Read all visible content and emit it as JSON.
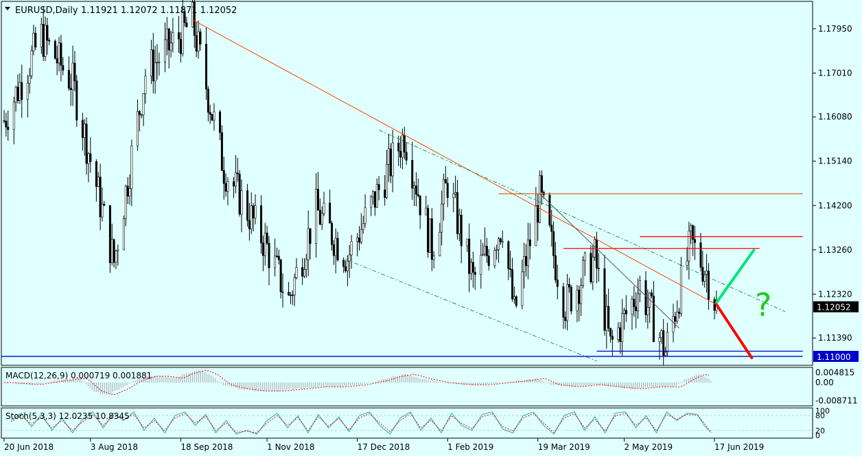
{
  "header": {
    "symbol": "EURUSD,Daily",
    "ohlc": "1.11921 1.12072 1.11871 1.12052"
  },
  "colors": {
    "background": "#e0ffff",
    "candle": "#000000",
    "trendline": "#ff4500",
    "channel": "#2e8b57",
    "resistance_orange": "#d2691e",
    "resistance_red": "#ff0000",
    "support_blue": "#0000cd",
    "bullish_arrow": "#00e676",
    "bearish_arrow": "#ff0000",
    "question_mark": "#22cc22",
    "macd_signal": "#ff0000",
    "macd_hist": "#a9a9a9",
    "stoch_main": "#20b2aa",
    "stoch_signal": "#ff0000"
  },
  "chart_data": [
    {
      "type": "candlestick",
      "title": "EURUSD,Daily",
      "ylim": [
        1.1081,
        1.1853
      ],
      "y_ticks": [
        "1.17950",
        "1.17010",
        "1.16080",
        "1.15140",
        "1.14200",
        "1.13260",
        "1.12320",
        "1.11390"
      ],
      "current_price": "1.12052",
      "support_label": "1.11000",
      "x_ticks": [
        "20 Jun 2018",
        "3 Aug 2018",
        "18 Sep 2018",
        "1 Nov 2018",
        "17 Dec 2018",
        "1 Feb 2019",
        "19 Mar 2019",
        "2 May 2019",
        "17 Jun 2019"
      ],
      "swing_points": [
        {
          "date": "2018-06-20",
          "price": 1.16
        },
        {
          "date": "2018-07-09",
          "price": 1.178
        },
        {
          "date": "2018-07-25",
          "price": 1.168
        },
        {
          "date": "2018-08-15",
          "price": 1.13
        },
        {
          "date": "2018-08-31",
          "price": 1.17
        },
        {
          "date": "2018-09-24",
          "price": 1.181
        },
        {
          "date": "2018-10-10",
          "price": 1.15
        },
        {
          "date": "2018-10-31",
          "price": 1.134
        },
        {
          "date": "2018-11-12",
          "price": 1.122
        },
        {
          "date": "2018-11-26",
          "price": 1.141
        },
        {
          "date": "2018-12-12",
          "price": 1.131
        },
        {
          "date": "2019-01-10",
          "price": 1.157
        },
        {
          "date": "2019-01-24",
          "price": 1.133
        },
        {
          "date": "2019-02-01",
          "price": 1.147
        },
        {
          "date": "2019-02-14",
          "price": 1.126
        },
        {
          "date": "2019-03-01",
          "price": 1.138
        },
        {
          "date": "2019-03-07",
          "price": 1.119
        },
        {
          "date": "2019-03-20",
          "price": 1.144
        },
        {
          "date": "2019-04-02",
          "price": 1.121
        },
        {
          "date": "2019-04-17",
          "price": 1.131
        },
        {
          "date": "2019-04-25",
          "price": 1.112
        },
        {
          "date": "2019-05-10",
          "price": 1.125
        },
        {
          "date": "2019-05-23",
          "price": 1.111
        },
        {
          "date": "2019-06-05",
          "price": 1.134
        },
        {
          "date": "2019-06-13",
          "price": 1.128
        },
        {
          "date": "2019-06-18",
          "price": 1.1205
        }
      ],
      "annotations": {
        "question_mark": "?",
        "horizontal_lines": [
          {
            "price": 1.1445,
            "from": "2019-02-27",
            "to": "2019-08-01",
            "color": "#d2691e"
          },
          {
            "price": 1.1354,
            "from": "2019-05-10",
            "to": "2019-08-01",
            "color": "#ff0000"
          },
          {
            "price": 1.1329,
            "from": "2019-04-01",
            "to": "2019-07-10",
            "color": "#ff0000"
          },
          {
            "price": 1.1111,
            "from": "2019-04-18",
            "to": "2019-08-01",
            "color": "#0000cd"
          },
          {
            "price": 1.11,
            "from": "2018-06-01",
            "to": "2019-08-01",
            "color": "#0000cd"
          }
        ],
        "trendlines": [
          {
            "from": [
              "2018-09-24",
              1.1814
            ],
            "to": [
              "2019-06-18",
              1.121
            ],
            "color": "#ff4500"
          },
          {
            "from": [
              "2019-03-20",
              1.1445
            ],
            "to": [
              "2019-05-30",
              1.116
            ],
            "color": "#555555"
          },
          {
            "from": [
              "2018-12-28",
              1.158
            ],
            "to": [
              "2019-07-23",
              1.1195
            ],
            "color": "#2e8b57",
            "dashed": true
          },
          {
            "from": [
              "2018-12-11",
              1.1306
            ],
            "to": [
              "2019-04-18",
              1.109
            ],
            "color": "#2e8b57",
            "dashed": true
          }
        ],
        "arrows": [
          {
            "from": [
              "2019-06-18",
              1.1214
            ],
            "to": [
              "2019-07-07",
              1.1325
            ],
            "color": "#00e676"
          },
          {
            "from": [
              "2019-06-18",
              1.121
            ],
            "to": [
              "2019-07-06",
              1.1097
            ],
            "color": "#ff0000"
          }
        ]
      }
    },
    {
      "type": "line",
      "title": "MACD(12,26,9) 0.000719 0.001881",
      "y_ticks": [
        "0.004815",
        "0.00",
        "-0.008711"
      ],
      "ylim": [
        -0.0105,
        0.0066
      ],
      "series": [
        {
          "values": [
            [
              0,
              0.0
            ],
            [
              40,
              -0.001
            ],
            [
              80,
              0.001
            ],
            [
              110,
              0.002
            ],
            [
              130,
              -0.004
            ],
            [
              148,
              -0.006
            ],
            [
              170,
              -0.003
            ],
            [
              190,
              0.001
            ],
            [
              210,
              0.003
            ],
            [
              230,
              0.003
            ],
            [
              250,
              0.002
            ],
            [
              262,
              0.004
            ],
            [
              285,
              0.006
            ],
            [
              300,
              0.004
            ],
            [
              320,
              -0.001
            ],
            [
              345,
              -0.003
            ],
            [
              370,
              -0.004
            ],
            [
              400,
              -0.004
            ],
            [
              430,
              -0.003
            ],
            [
              460,
              -0.002
            ],
            [
              490,
              -0.002
            ],
            [
              520,
              -0.001
            ],
            [
              550,
              0.001
            ],
            [
              570,
              0.003
            ],
            [
              590,
              0.004
            ],
            [
              610,
              0.002
            ],
            [
              640,
              0.0
            ],
            [
              670,
              -0.001
            ],
            [
              700,
              -0.001
            ],
            [
              730,
              0.0
            ],
            [
              760,
              0.001
            ],
            [
              780,
              0.002
            ],
            [
              800,
              -0.001
            ],
            [
              830,
              -0.002
            ],
            [
              860,
              -0.001
            ],
            [
              890,
              -0.002
            ],
            [
              920,
              -0.003
            ],
            [
              950,
              -0.002
            ],
            [
              980,
              -0.002
            ],
            [
              1000,
              0.002
            ],
            [
              1015,
              0.004
            ],
            [
              1025,
              0.003
            ],
            [
              1035,
              0.001
            ]
          ]
        }
      ]
    },
    {
      "type": "line",
      "title": "Stoch(5,3,3) 12.0235 10.8345",
      "y_ticks": [
        "100",
        "80",
        "20",
        "0"
      ],
      "ylim": [
        0,
        100
      ],
      "series": [
        {
          "values": [
            [
              10,
              60
            ],
            [
              25,
              90
            ],
            [
              40,
              35
            ],
            [
              55,
              85
            ],
            [
              70,
              20
            ],
            [
              85,
              70
            ],
            [
              100,
              10
            ],
            [
              115,
              65
            ],
            [
              130,
              95
            ],
            [
              145,
              30
            ],
            [
              160,
              90
            ],
            [
              175,
              60
            ],
            [
              190,
              95
            ],
            [
              205,
              20
            ],
            [
              220,
              70
            ],
            [
              235,
              10
            ],
            [
              250,
              80
            ],
            [
              265,
              95
            ],
            [
              280,
              40
            ],
            [
              295,
              85
            ],
            [
              310,
              10
            ],
            [
              325,
              60
            ],
            [
              340,
              5
            ],
            [
              355,
              20
            ],
            [
              370,
              5
            ],
            [
              385,
              60
            ],
            [
              400,
              90
            ],
            [
              415,
              30
            ],
            [
              430,
              80
            ],
            [
              445,
              10
            ],
            [
              460,
              85
            ],
            [
              475,
              30
            ],
            [
              490,
              75
            ],
            [
              505,
              15
            ],
            [
              520,
              80
            ],
            [
              535,
              95
            ],
            [
              550,
              40
            ],
            [
              565,
              5
            ],
            [
              580,
              70
            ],
            [
              595,
              95
            ],
            [
              610,
              20
            ],
            [
              625,
              70
            ],
            [
              640,
              10
            ],
            [
              655,
              90
            ],
            [
              670,
              40
            ],
            [
              685,
              20
            ],
            [
              700,
              85
            ],
            [
              715,
              95
            ],
            [
              730,
              25
            ],
            [
              745,
              10
            ],
            [
              760,
              80
            ],
            [
              775,
              95
            ],
            [
              790,
              40
            ],
            [
              805,
              5
            ],
            [
              820,
              80
            ],
            [
              835,
              95
            ],
            [
              850,
              20
            ],
            [
              865,
              75
            ],
            [
              880,
              10
            ],
            [
              895,
              90
            ],
            [
              910,
              95
            ],
            [
              925,
              30
            ],
            [
              940,
              80
            ],
            [
              955,
              10
            ],
            [
              970,
              95
            ],
            [
              985,
              60
            ],
            [
              1000,
              90
            ],
            [
              1015,
              85
            ],
            [
              1025,
              40
            ],
            [
              1035,
              12
            ]
          ]
        },
        {
          "values": [
            [
              10,
              55
            ],
            [
              25,
              80
            ],
            [
              40,
              45
            ],
            [
              55,
              75
            ],
            [
              70,
              30
            ],
            [
              85,
              60
            ],
            [
              100,
              20
            ],
            [
              115,
              55
            ],
            [
              130,
              85
            ],
            [
              145,
              40
            ],
            [
              160,
              80
            ],
            [
              175,
              65
            ],
            [
              190,
              85
            ],
            [
              205,
              30
            ],
            [
              220,
              60
            ],
            [
              235,
              20
            ],
            [
              250,
              70
            ],
            [
              265,
              88
            ],
            [
              280,
              50
            ],
            [
              295,
              78
            ],
            [
              310,
              20
            ],
            [
              325,
              50
            ],
            [
              340,
              12
            ],
            [
              355,
              18
            ],
            [
              370,
              10
            ],
            [
              385,
              50
            ],
            [
              400,
              80
            ],
            [
              415,
              40
            ],
            [
              430,
              72
            ],
            [
              445,
              20
            ],
            [
              460,
              75
            ],
            [
              475,
              38
            ],
            [
              490,
              68
            ],
            [
              505,
              22
            ],
            [
              520,
              70
            ],
            [
              535,
              88
            ],
            [
              550,
              50
            ],
            [
              565,
              15
            ],
            [
              580,
              60
            ],
            [
              595,
              88
            ],
            [
              610,
              30
            ],
            [
              625,
              62
            ],
            [
              640,
              18
            ],
            [
              655,
              80
            ],
            [
              670,
              48
            ],
            [
              685,
              28
            ],
            [
              700,
              75
            ],
            [
              715,
              88
            ],
            [
              730,
              35
            ],
            [
              745,
              18
            ],
            [
              760,
              70
            ],
            [
              775,
              88
            ],
            [
              790,
              50
            ],
            [
              805,
              12
            ],
            [
              820,
              70
            ],
            [
              835,
              88
            ],
            [
              850,
              30
            ],
            [
              865,
              65
            ],
            [
              880,
              18
            ],
            [
              895,
              80
            ],
            [
              910,
              88
            ],
            [
              925,
              40
            ],
            [
              940,
              72
            ],
            [
              955,
              18
            ],
            [
              970,
              85
            ],
            [
              985,
              65
            ],
            [
              1000,
              85
            ],
            [
              1015,
              82
            ],
            [
              1025,
              50
            ],
            [
              1035,
              11
            ]
          ]
        }
      ]
    }
  ]
}
